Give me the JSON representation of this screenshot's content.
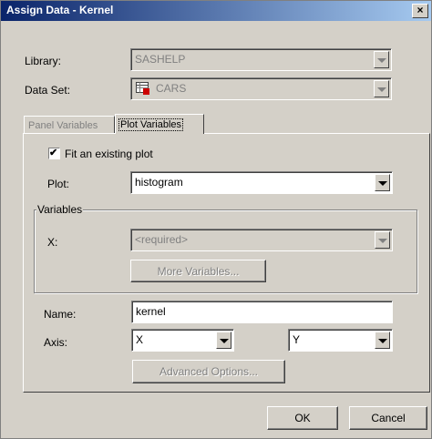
{
  "window": {
    "title": "Assign Data - Kernel",
    "close_glyph": "×"
  },
  "library": {
    "label": "Library:",
    "value": "SASHELP"
  },
  "dataset": {
    "label": "Data Set:",
    "value": "CARS"
  },
  "tabs": [
    {
      "label": "Panel Variables",
      "active": false
    },
    {
      "label": "Plot Variables",
      "active": true
    }
  ],
  "fit": {
    "label": "Fit an existing plot",
    "checked": true,
    "check_glyph": "✔"
  },
  "plot": {
    "label": "Plot:",
    "value": "histogram"
  },
  "variables": {
    "legend": "Variables",
    "x_label": "X:",
    "x_value": "<required>",
    "more_button": "More Variables..."
  },
  "name": {
    "label": "Name:",
    "value": "kernel"
  },
  "axis": {
    "label": "Axis:",
    "x_value": "X",
    "y_value": "Y"
  },
  "advanced_button": "Advanced Options...",
  "ok_button": "OK",
  "cancel_button": "Cancel",
  "colors": {
    "title_start": "#0a246a",
    "title_end": "#a6caf0",
    "face": "#d4d0c8",
    "disabled_text": "#808080",
    "dataset_icon_red": "#cc0000"
  }
}
